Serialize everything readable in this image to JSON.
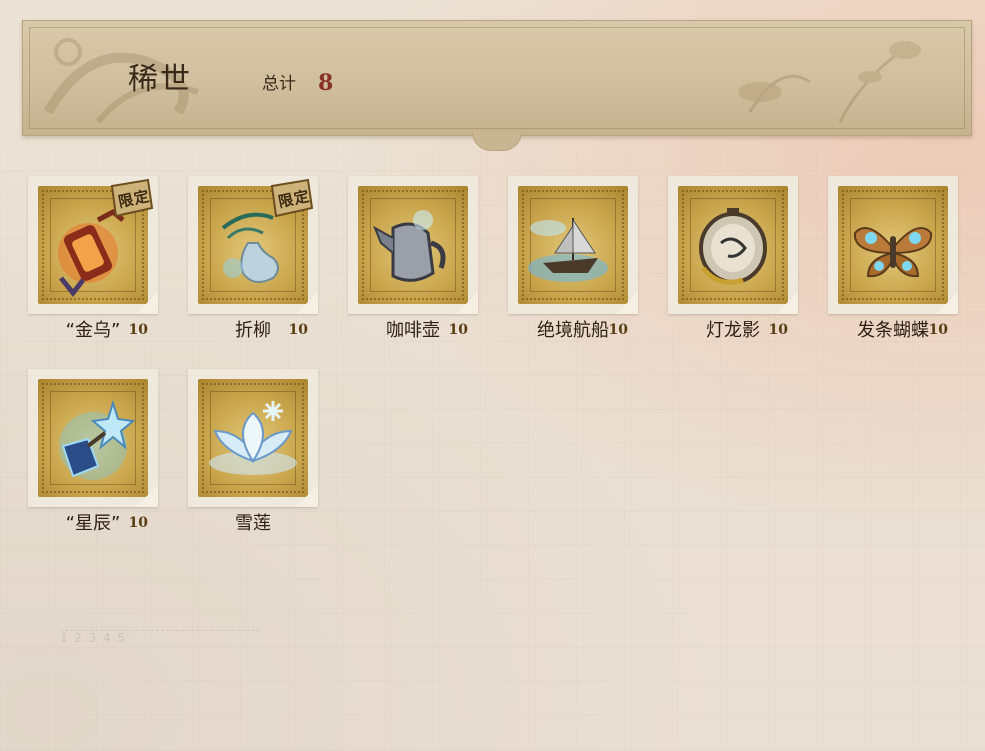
{
  "header": {
    "title": "稀世",
    "total_label": "总计",
    "total_value": "8"
  },
  "items": [
    {
      "label": "“金乌”",
      "limited": "限定",
      "number": "10",
      "icon": "golden-crow-lantern-icon"
    },
    {
      "label": "折柳",
      "limited": "限定",
      "number": "10",
      "icon": "willow-vase-icon"
    },
    {
      "label": "咖啡壶",
      "limited": "",
      "number": "10",
      "icon": "coffee-pot-icon"
    },
    {
      "label": "绝境航船",
      "limited": "",
      "number": "10",
      "icon": "sailing-ship-icon"
    },
    {
      "label": "灯龙影",
      "limited": "",
      "number": "10",
      "icon": "dragon-lantern-icon"
    },
    {
      "label": "发条蝴蝶",
      "limited": "",
      "number": "10",
      "icon": "clockwork-butterfly-icon"
    },
    {
      "label": "“星辰”",
      "limited": "",
      "number": "10",
      "icon": "star-crystal-icon"
    },
    {
      "label": "雪莲",
      "limited": "",
      "number": "",
      "icon": "snow-lotus-icon"
    }
  ],
  "ruler_text": "1 2 3 4 5"
}
